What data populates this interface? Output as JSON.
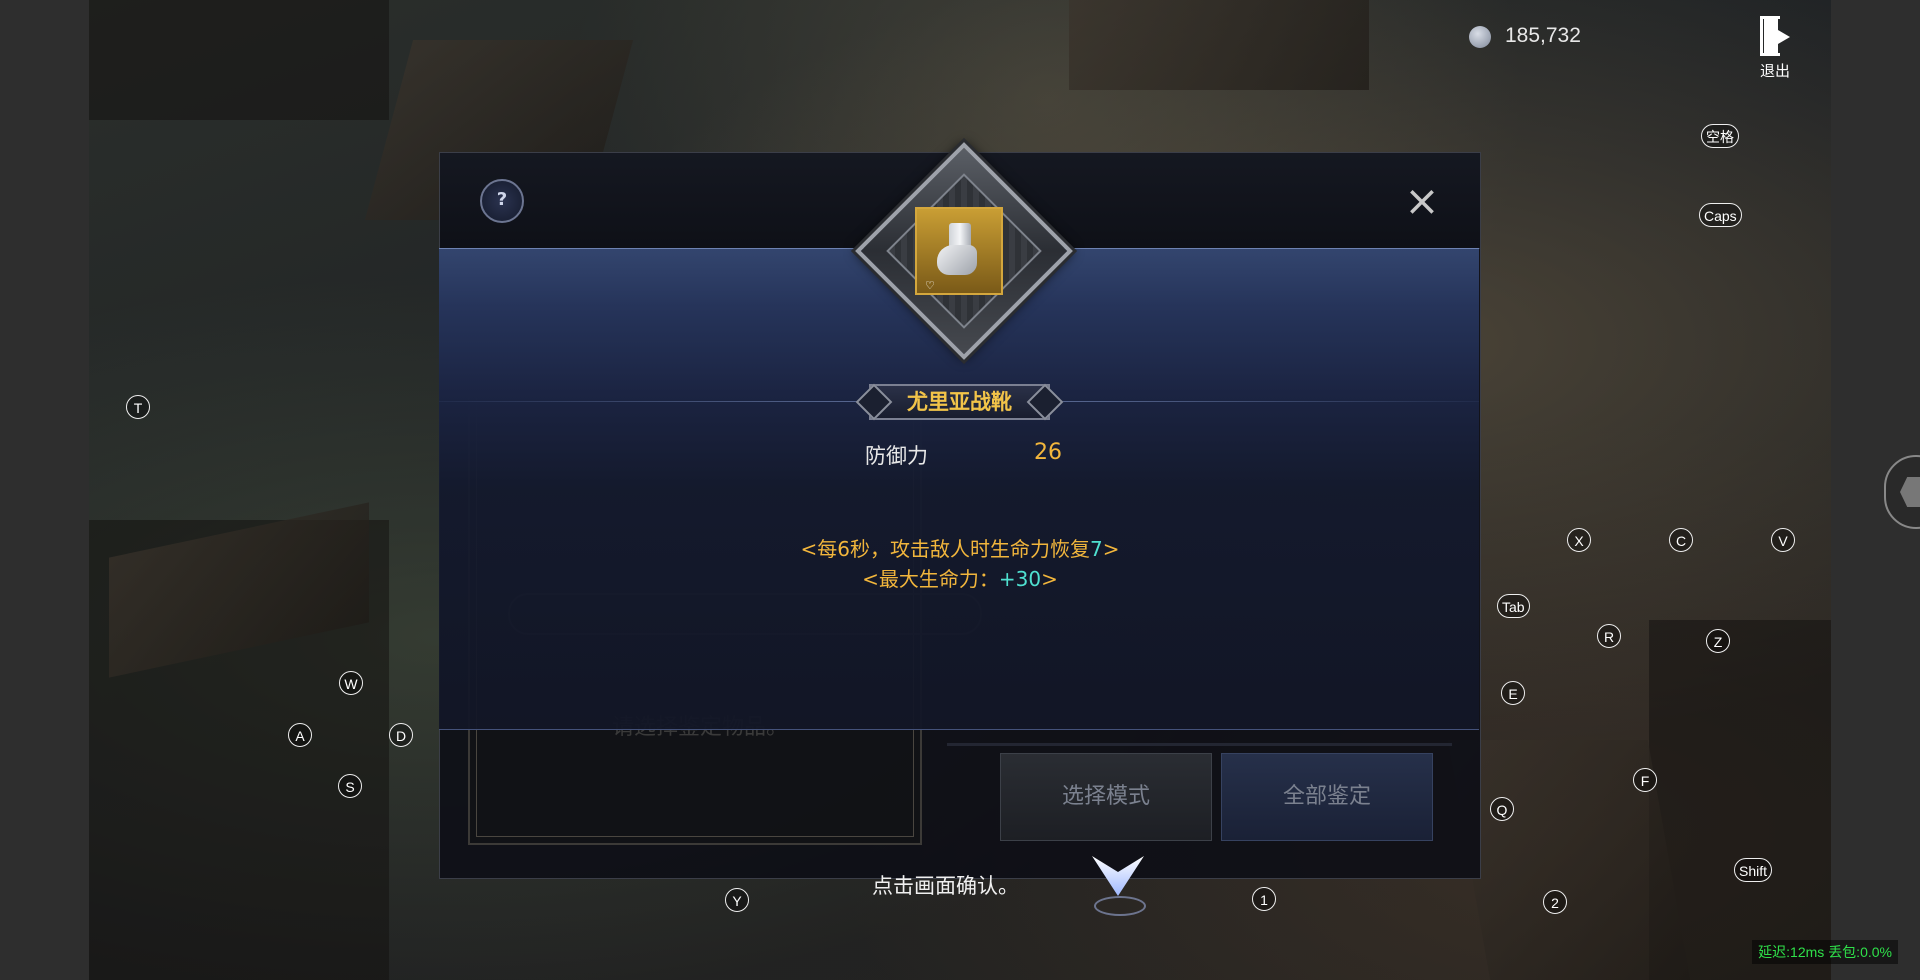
{
  "hud": {
    "currency_icon": "silver-coin-icon",
    "currency_amount": "185,732",
    "exit_label": "退出"
  },
  "keys": {
    "space": "空格",
    "caps": "Caps",
    "t": "T",
    "x": "X",
    "c": "C",
    "v": "V",
    "tab": "Tab",
    "r": "R",
    "z": "Z",
    "e": "E",
    "w": "W",
    "a": "A",
    "d": "D",
    "s": "S",
    "f": "F",
    "q": "Q",
    "y": "Y",
    "one": "1",
    "two": "2",
    "shift": "Shift"
  },
  "status": {
    "latency": "延迟:12ms",
    "packet_loss": "丢包:0.0%",
    "color": "#2fe04a"
  },
  "panel": {
    "help_icon": "?",
    "close_icon": "×",
    "prompt_text": "请选择鉴定物品。",
    "select_mode_button": "选择模式",
    "identify_all_button": "全部鉴定"
  },
  "item": {
    "name": "尤里亚战靴",
    "name_color": "#f2c449",
    "icon": "armored-boot-icon",
    "stat_label": "防御力",
    "stat_value": "26",
    "effect1_prefix": "<每6秒，攻击敌人时生命力恢复",
    "effect1_value": "7",
    "effect1_suffix": ">",
    "effect2_prefix": "<最大生命力：",
    "effect2_value": "+30",
    "effect2_suffix": ">"
  },
  "confirm_text": "点击画面确认。"
}
